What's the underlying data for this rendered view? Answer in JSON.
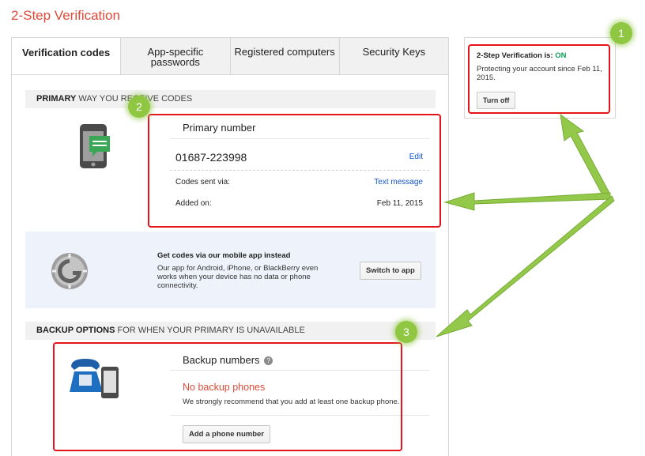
{
  "page": {
    "title": "2-Step Verification"
  },
  "tabs": [
    {
      "label": "Verification codes"
    },
    {
      "label": "App-specific passwords"
    },
    {
      "label": "Registered computers"
    },
    {
      "label": "Security Keys"
    }
  ],
  "primary_section": {
    "heading_bold": "PRIMARY",
    "heading_rest": " WAY YOU RECEIVE CODES",
    "box_title": "Primary number",
    "phone": "01687-223998",
    "edit_label": "Edit",
    "codes_label": "Codes sent via:",
    "codes_value": "Text message",
    "added_label": "Added on:",
    "added_value": "Feb 11, 2015"
  },
  "mobile_app": {
    "title": "Get codes via our mobile app instead",
    "description": "Our app for Android, iPhone, or BlackBerry even works when your device has no data or phone connectivity.",
    "button": "Switch to app"
  },
  "backup_section": {
    "heading_bold": "BACKUP OPTIONS",
    "heading_rest": " FOR WHEN YOUR PRIMARY IS UNAVAILABLE",
    "box_title": "Backup numbers",
    "help_glyph": "?",
    "empty_title": "No backup phones",
    "empty_text": "We strongly recommend that you add at least one backup phone.",
    "add_button": "Add a phone number"
  },
  "status_card": {
    "label": "2-Step Verification is: ",
    "status": "ON",
    "status_color": "#0f9d58",
    "since": "Protecting your account since Feb 11, 2015.",
    "button": "Turn off"
  },
  "annotations": {
    "one": "1",
    "two": "2",
    "three": "3"
  },
  "colors": {
    "title": "#dd4b39",
    "annotation_box": "#e5141b",
    "annotation_badge": "#8fc642",
    "link": "#1155cc",
    "warning": "#dd4b39"
  }
}
